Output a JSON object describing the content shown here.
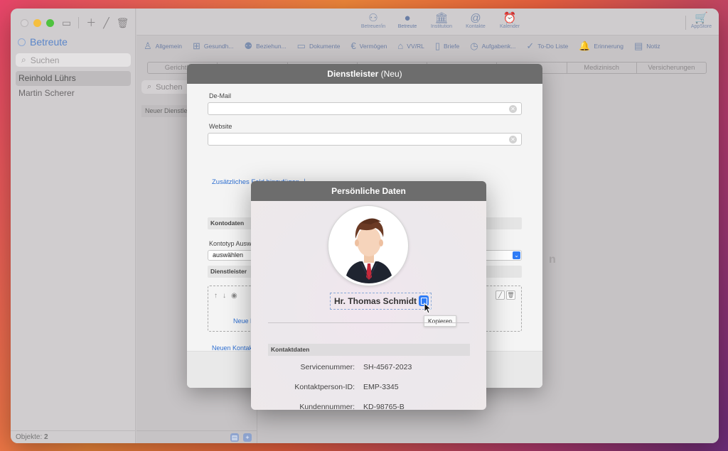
{
  "sidebar": {
    "title": "Betreute",
    "search_placeholder": "Suchen",
    "items": [
      {
        "label": "Reinhold Lührs"
      },
      {
        "label": "Martin Scherer"
      }
    ],
    "footer_label": "Objekte:",
    "footer_count": "2"
  },
  "toolbar": {
    "items": [
      {
        "label": "Betreuer/in",
        "icon": "people-icon"
      },
      {
        "label": "Betreute",
        "icon": "person-icon"
      },
      {
        "label": "Institution",
        "icon": "building-icon"
      },
      {
        "label": "Kontakte",
        "icon": "at-icon"
      },
      {
        "label": "Kalender",
        "icon": "alarm-icon"
      }
    ],
    "appstore_label": "AppStore"
  },
  "tabs": [
    {
      "label": "Allgemein",
      "icon": "person-outline-icon"
    },
    {
      "label": "Gesundh...",
      "icon": "medical-bag-icon"
    },
    {
      "label": "Beziehun...",
      "icon": "people-icon"
    },
    {
      "label": "Dokumente",
      "icon": "folder-icon"
    },
    {
      "label": "Vermögen",
      "icon": "euro-icon"
    },
    {
      "label": "VV/RL",
      "icon": "building-icon"
    },
    {
      "label": "Briefe",
      "icon": "document-icon"
    },
    {
      "label": "Aufgabenk...",
      "icon": "clock-icon"
    },
    {
      "label": "To-Do Liste",
      "icon": "check-icon"
    },
    {
      "label": "Erinnerung",
      "icon": "bell-icon"
    },
    {
      "label": "Notiz",
      "icon": "note-icon"
    }
  ],
  "subtabs": [
    "Gerichtl. Be",
    "",
    "",
    "",
    "",
    "",
    "Medizinisch",
    "Versicherungen"
  ],
  "list": {
    "search_placeholder": "Suchen",
    "item": "Neuer Dienstleister"
  },
  "background_text": "n",
  "dialog": {
    "title_bold": "Dienstleister",
    "title_suffix": "(Neu)",
    "demail_label": "De-Mail",
    "website_label": "Website",
    "add_field_label": "Zusätzliches Feld hinzufügen",
    "kontodaten_label": "Kontodaten",
    "kontotyp_label": "Kontotyp Auswählen",
    "select_value": "auswählen",
    "dienstleister_label": "Dienstleister",
    "new_dl_label": "Neue Dienstleister",
    "new_contact_label": "Neuen Kontakt"
  },
  "popover": {
    "title": "Persönliche Daten",
    "name": "Hr. Thomas Schmidt",
    "tooltip": "Kopieren",
    "section": "Kontaktdaten",
    "rows": [
      {
        "key": "Servicenummer:",
        "value": "SH-4567-2023"
      },
      {
        "key": "Kontaktperson-ID:",
        "value": "EMP-3345"
      },
      {
        "key": "Kundennummer:",
        "value": "KD-98765-B"
      }
    ]
  },
  "colors": {
    "accent": "#2f7cf6",
    "link": "#2e6fd1",
    "header": "#6d6d6d"
  }
}
